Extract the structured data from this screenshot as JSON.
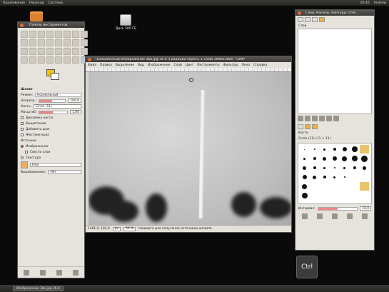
{
  "top_panel": {
    "menus": [
      "Приложения",
      "Переход",
      "Система"
    ],
    "clock": "20:40",
    "user": "Andrew"
  },
  "desktop": {
    "drive_label": "Диск 500 ГБ"
  },
  "toolbox": {
    "title": "Панель инструментов",
    "options_title": "Шланг",
    "mode_label": "Режим:",
    "mode_value": "Нормальный",
    "opacity_label": "Непрозр.:",
    "opacity_value": "100,0",
    "brush_label": "Кисть:",
    "brush_value": "Circle (11)",
    "scale_label": "Масштаб:",
    "scale_value": "1,00",
    "dynamic_label": "Динамика кисти",
    "fade_label": "Выцветание",
    "jitter_label": "Добавить шум",
    "hard_label": "Жесткие края",
    "source_title": "Источник",
    "source_image": "Изображение",
    "source_sample": "Свести слои",
    "source_pattern": "Текстура",
    "pattern_value": "Pine",
    "align_label": "Выравнивание:",
    "align_value": "Нет"
  },
  "image_window": {
    "title": "[Безымянный] Изображение 3ba.jpg-36.0 (Градации серого, 1 слой) 2896x1864 – GIMP",
    "menus": [
      "Файл",
      "Правка",
      "Выделение",
      "Вид",
      "Изображение",
      "Слой",
      "Цвет",
      "Инструменты",
      "Фильтры",
      "Окна",
      "Справка"
    ],
    "coords": "1481,0, 183,0",
    "unit": "px",
    "zoom": "50 %",
    "status": "Нажмите для получения источника штампа"
  },
  "dock": {
    "title": "Слои, Каналы, Контуры, Отм...",
    "layers_label": "Слои",
    "brushes_title": "Кисти",
    "brush_name": "Circle (11) (11 × 11)",
    "spacing_label": "Интервал:",
    "spacing_value": "10,0"
  },
  "key_indicator": "Ctrl",
  "bottom_panel": {
    "task": "Изображение 3ba.jpg-36.0"
  }
}
